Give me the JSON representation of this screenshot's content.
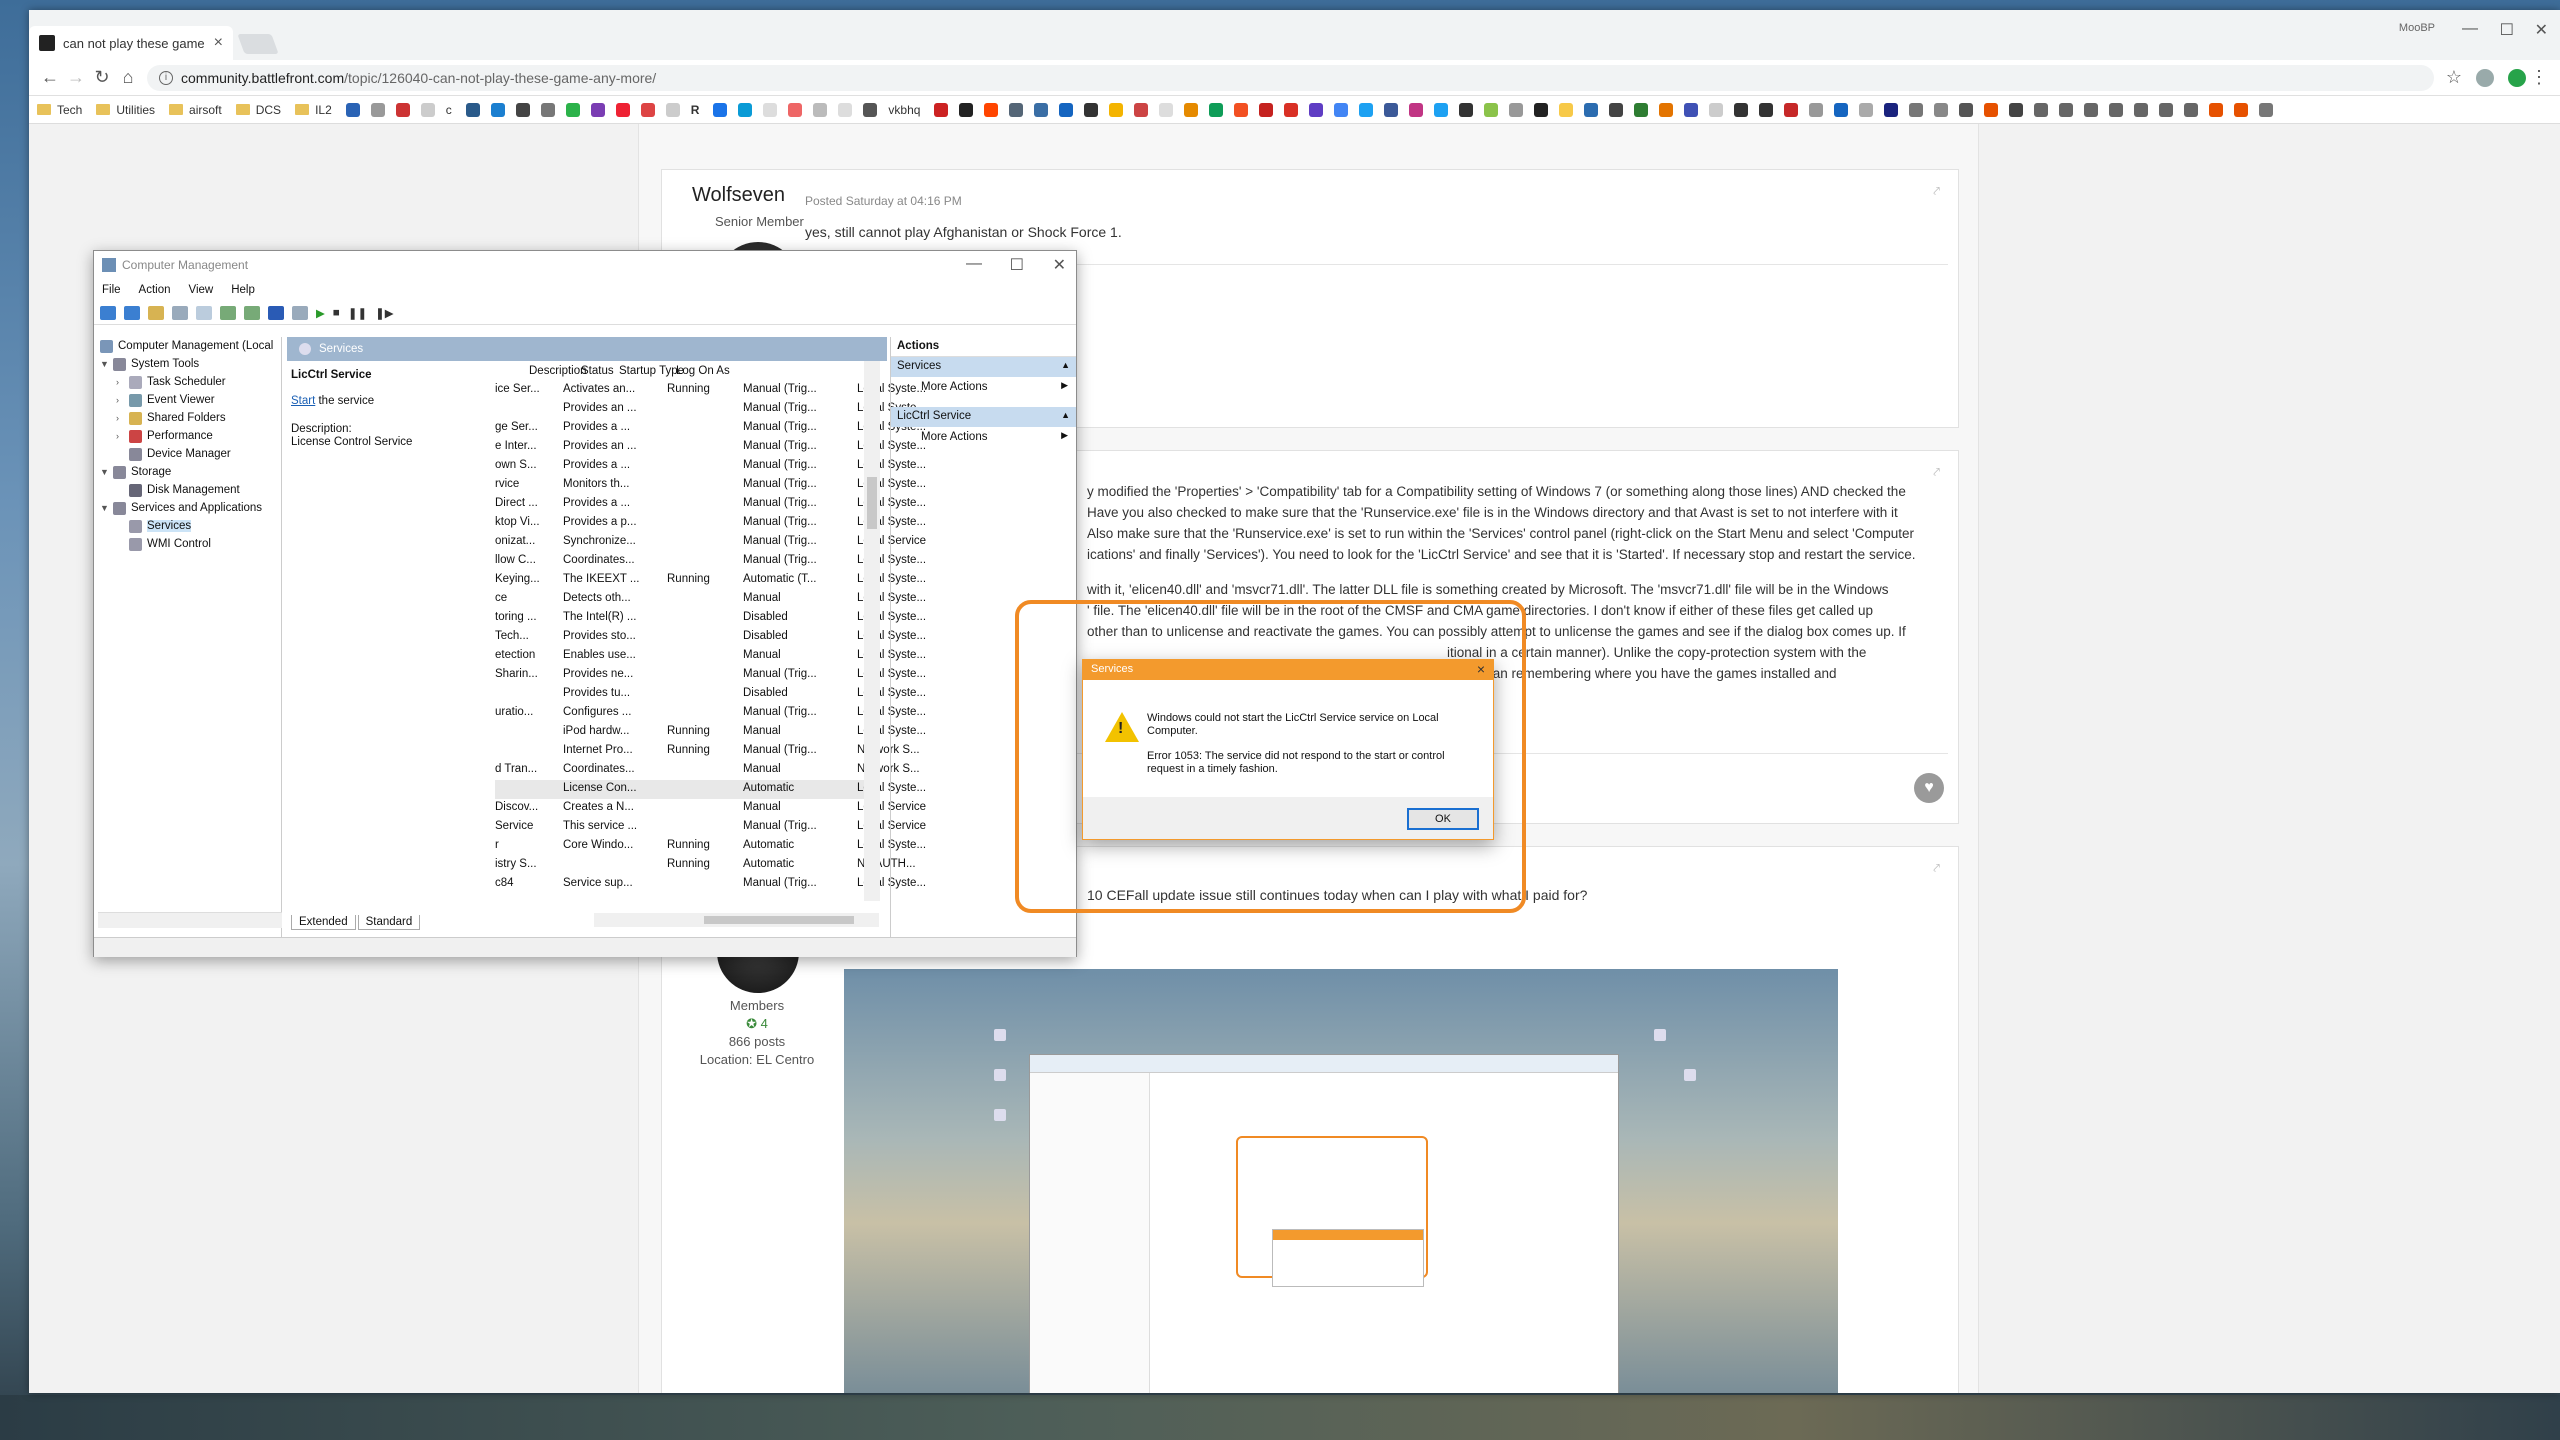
{
  "browser": {
    "tab_title": "can not play these game any more",
    "tab_close": "×",
    "profile": "MooBP",
    "url_host": "community.battlefront.com",
    "url_path": "/topic/126040-can-not-play-these-game-any-more/",
    "bookmarks": [
      "Tech",
      "Utilities",
      "airsoft",
      "DCS",
      "IL2"
    ],
    "bookmark_vk": "vkbhq",
    "bookmark_c": "c",
    "bookmark_r": "R"
  },
  "posts": {
    "p1": {
      "author": "Wolfseven",
      "role": "Senior Member",
      "posted": "Posted Saturday at 04:16 PM",
      "text": "yes, still cannot play Afghanistan or Shock Force 1."
    },
    "p2": {
      "lines": [
        "y modified the 'Properties' > 'Compatibility' tab for a Compatibility setting of Windows 7 (or something along those lines) AND checked the",
        "Have you also checked to make sure that the 'Runservice.exe' file is in the Windows directory and that Avast is set to not interfere with it",
        "Also make sure that the 'Runservice.exe' is set to run within the 'Services' control panel (right-click on the Start Menu and select 'Computer",
        "ications' and finally 'Services'). You need to look for the 'LicCtrl Service' and see that it is 'Started'. If necessary stop and restart the service.",
        "",
        "with it, 'elicen40.dll' and 'msvcr71.dll'. The latter DLL file is something created by Microsoft. The 'msvcr71.dll' file will be in the Windows",
        "' file. The 'elicen40.dll' file will be in the root of the CMSF and CMA game directories. I don't know if either of these files get called up",
        "other than to unlicense and reactivate the games. You can possibly attempt to unlicense the games and see if the dialog box comes up. If",
        "itional in a certain manner). Unlike the copy-protection system with the",
        "other than remembering where you have the games installed and",
        "a"
      ]
    },
    "p3": {
      "text": "10 CEFall update issue still continues today when can I play with what I paid for?",
      "group": "Members",
      "reputation": "4",
      "posts": "866 posts",
      "location": "Location: EL Centro"
    }
  },
  "computer_management": {
    "title": "Computer Management",
    "menu": [
      "File",
      "Action",
      "View",
      "Help"
    ],
    "tree": {
      "root": "Computer Management (Local",
      "system_tools": "System Tools",
      "task_scheduler": "Task Scheduler",
      "event_viewer": "Event Viewer",
      "shared_folders": "Shared Folders",
      "performance": "Performance",
      "device_manager": "Device Manager",
      "storage": "Storage",
      "disk_management": "Disk Management",
      "services_apps": "Services and Applications",
      "services": "Services",
      "wmi": "WMI Control"
    },
    "panel_header": "Services",
    "service_name": "LicCtrl Service",
    "start_link": "Start",
    "start_rest": " the service",
    "description_label": "Description:",
    "description": "License Control Service",
    "columns": [
      "Description",
      "Status",
      "Startup Type",
      "Log On As"
    ],
    "rows": [
      [
        "ice Ser...",
        "Activates an...",
        "Running",
        "Manual (Trig...",
        "Local Syste..."
      ],
      [
        "",
        "Provides an ...",
        "",
        "Manual (Trig...",
        "Local Syste..."
      ],
      [
        "ge Ser...",
        "Provides a ...",
        "",
        "Manual (Trig...",
        "Local Syste..."
      ],
      [
        "e Inter...",
        "Provides an ...",
        "",
        "Manual (Trig...",
        "Local Syste..."
      ],
      [
        "own S...",
        "Provides a ...",
        "",
        "Manual (Trig...",
        "Local Syste..."
      ],
      [
        "rvice",
        "Monitors th...",
        "",
        "Manual (Trig...",
        "Local Syste..."
      ],
      [
        "Direct ...",
        "Provides a ...",
        "",
        "Manual (Trig...",
        "Local Syste..."
      ],
      [
        "ktop Vi...",
        "Provides a p...",
        "",
        "Manual (Trig...",
        "Local Syste..."
      ],
      [
        "onizat...",
        "Synchronize...",
        "",
        "Manual (Trig...",
        "Local Service"
      ],
      [
        "llow C...",
        "Coordinates...",
        "",
        "Manual (Trig...",
        "Local Syste..."
      ],
      [
        "Keying...",
        "The IKEEXT ...",
        "Running",
        "Automatic (T...",
        "Local Syste..."
      ],
      [
        "ce",
        "Detects oth...",
        "",
        "Manual",
        "Local Syste..."
      ],
      [
        "toring ...",
        "The Intel(R) ...",
        "",
        "Disabled",
        "Local Syste..."
      ],
      [
        "Tech...",
        "Provides sto...",
        "",
        "Disabled",
        "Local Syste..."
      ],
      [
        "etection",
        "Enables use...",
        "",
        "Manual",
        "Local Syste..."
      ],
      [
        "Sharin...",
        "Provides ne...",
        "",
        "Manual (Trig...",
        "Local Syste..."
      ],
      [
        "",
        "Provides tu...",
        "",
        "Disabled",
        "Local Syste..."
      ],
      [
        "uratio...",
        "Configures ...",
        "",
        "Manual (Trig...",
        "Local Syste..."
      ],
      [
        "",
        "iPod hardw...",
        "Running",
        "Manual",
        "Local Syste..."
      ],
      [
        "",
        "Internet Pro...",
        "Running",
        "Manual (Trig...",
        "Network S..."
      ],
      [
        "d Tran...",
        "Coordinates...",
        "",
        "Manual",
        "Network S..."
      ],
      [
        "",
        "License Con...",
        "",
        "Automatic",
        "Local Syste..."
      ],
      [
        "Discov...",
        "Creates a N...",
        "",
        "Manual",
        "Local Service"
      ],
      [
        "Service",
        "This service ...",
        "",
        "Manual (Trig...",
        "Local Service"
      ],
      [
        "r",
        "Core Windo...",
        "Running",
        "Automatic",
        "Local Syste..."
      ],
      [
        "istry S...",
        "",
        "Running",
        "Automatic",
        "NT AUTH..."
      ],
      [
        "c84",
        "Service sup...",
        "",
        "Manual (Trig...",
        "Local Syste..."
      ]
    ],
    "view_tabs": [
      "Extended",
      "Standard"
    ],
    "actions": {
      "header": "Actions",
      "section1": "Services",
      "more1": "More Actions",
      "section2": "LicCtrl Service",
      "more2": "More Actions"
    }
  },
  "dialog": {
    "title": "Services",
    "close": "×",
    "message": "Windows could not start the LicCtrl Service service on Local Computer.",
    "error": "Error 1053: The service did not respond to the start or control request in a timely fashion.",
    "ok": "OK"
  },
  "colors": {
    "annotation": "#f08a24",
    "dialog_title": "#f39a2d",
    "warning": "#f2c200",
    "selection": "#cce4f7"
  },
  "icons": [
    "back-arrow-icon",
    "forward-arrow-icon",
    "reload-icon",
    "home-icon",
    "info-icon",
    "star-icon",
    "warning-icon",
    "heart-icon",
    "share-icon"
  ]
}
